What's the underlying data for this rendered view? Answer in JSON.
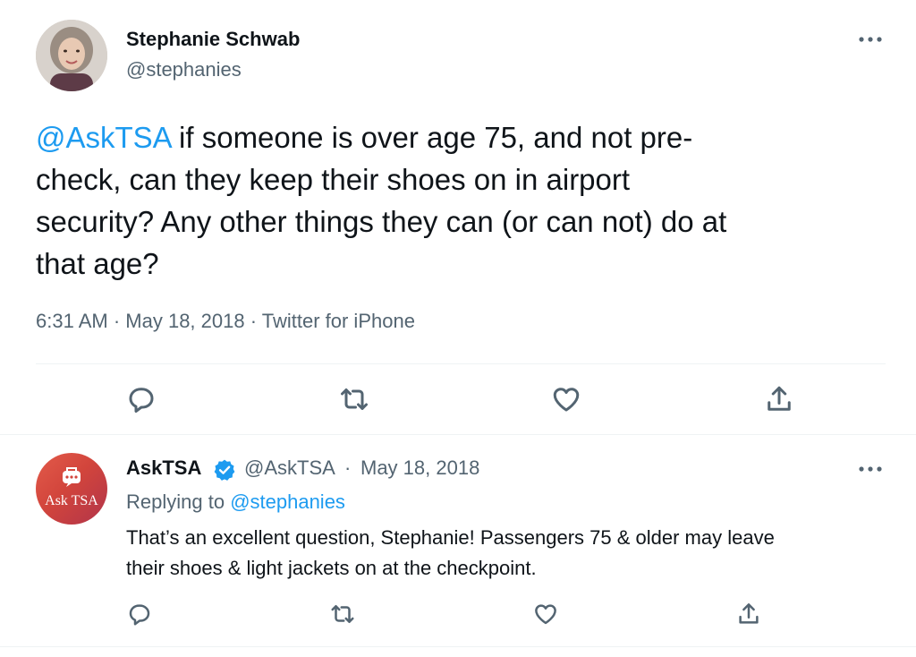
{
  "main_tweet": {
    "author": {
      "name": "Stephanie Schwab",
      "handle": "@stephanies"
    },
    "text": {
      "mention": "@AskTSA",
      "body_line1": " if someone is over age 75, and not pre-",
      "body_line2": "check, can they keep their shoes on in airport",
      "body_line3": "security? Any other things they can (or can not) do at",
      "body_line4": "that age?"
    },
    "meta": {
      "time": "6:31 AM",
      "separator": " · ",
      "date": "May 18, 2018",
      "source": "Twitter for iPhone"
    },
    "actions": [
      "reply-icon",
      "retweet-icon",
      "like-icon",
      "share-icon"
    ]
  },
  "reply_tweet": {
    "author": {
      "name": "AskTSA",
      "handle": "@AskTSA",
      "verified": true,
      "avatar_text": "Ask TSA"
    },
    "separator": "·",
    "date": "May 18, 2018",
    "replying_to_label": "Replying to ",
    "replying_to_handle": "@stephanies",
    "text_line1": "That’s an excellent question, Stephanie! Passengers 75 & older may leave",
    "text_line2": "their shoes & light jackets on at the checkpoint.",
    "actions": [
      "reply-icon",
      "retweet-icon",
      "like-icon",
      "share-icon"
    ]
  },
  "colors": {
    "accent": "#1d9bf0",
    "secondary_text": "#536471",
    "primary_text": "#0f1419",
    "divider": "#eff3f4",
    "asktsa_avatar": "#d2453c"
  }
}
